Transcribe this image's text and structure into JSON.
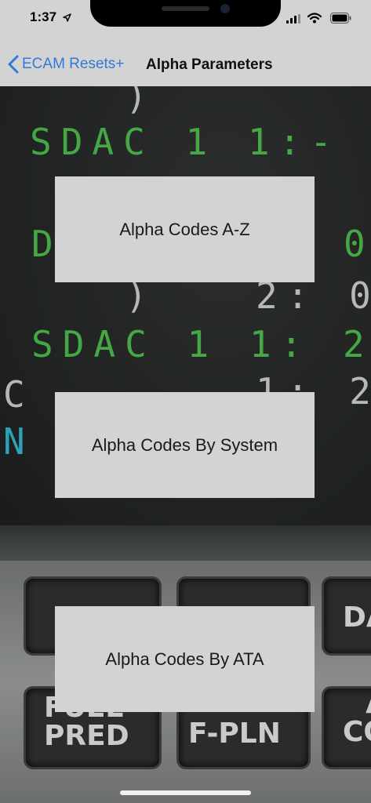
{
  "status_bar": {
    "time": "1:37"
  },
  "nav": {
    "back_label": "ECAM Resets+",
    "title": "Alpha Parameters"
  },
  "background": {
    "display_lines": [
      {
        "text": "SDAC 1 1:-",
        "color": "green"
      },
      {
        "text": "D",
        "color": "green"
      },
      {
        "text": "0",
        "color": "green"
      },
      {
        "text": "2: 0",
        "color": "white"
      },
      {
        "text": "SDAC 1 1: 2",
        "color": "green"
      },
      {
        "text": "C",
        "color": "white"
      },
      {
        "text": "1: 2",
        "color": "white"
      },
      {
        "text": "N",
        "color": "cyan"
      }
    ],
    "keys": {
      "fuel_pred": "FUEL\nPRED",
      "f_pln": "F-PLN",
      "da": "DA",
      "co": "A\nCO"
    }
  },
  "buttons": {
    "alpha_az": "Alpha Codes A-Z",
    "alpha_system": "Alpha Codes By System",
    "alpha_ata": "Alpha Codes By ATA"
  },
  "colors": {
    "accent": "#2f7bd8",
    "bar_background": "#d3d3d3",
    "button_background": "#d3d3d3",
    "ecam_green": "#4bbf4a"
  }
}
